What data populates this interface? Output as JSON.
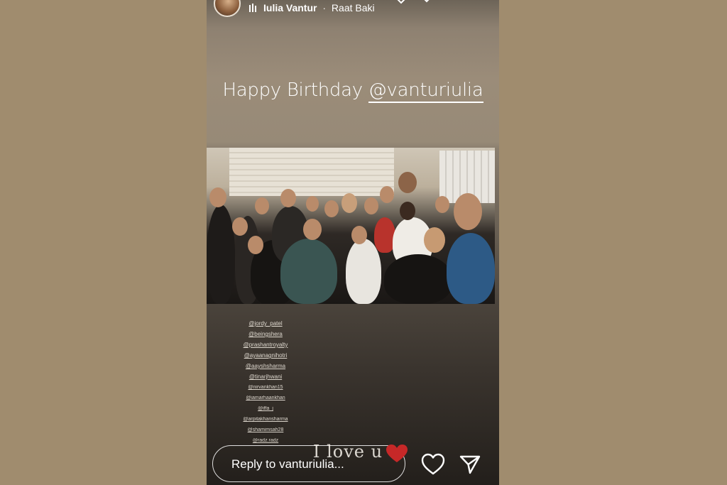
{
  "header": {
    "username": "Iulia Vantur",
    "separator": "·",
    "song": "Raat Baki"
  },
  "caption": {
    "prefix": "Happy Birthday",
    "mention": "@vanturiulia"
  },
  "tags": [
    "@jordy_patel",
    "@beingshera",
    "@prashantroyalty",
    "@ayaanagnihotri",
    "@aayshsharma",
    "@tinarjhwani",
    "@nirvankhan15",
    "@iamarhaankhan",
    "@iffa_j",
    "@arpitakhansharma",
    "@shamimsah28",
    "@radz.radz"
  ],
  "sticker_text": "I love u",
  "reply_placeholder": "Reply to vanturiulia...",
  "icons": {
    "like": "heart-icon",
    "send": "send-icon",
    "music": "music-bars-icon",
    "sticker": "red-heart-sticker"
  },
  "colors": {
    "page_background": "#a08c6e",
    "sticker_heart": "#c62828"
  }
}
